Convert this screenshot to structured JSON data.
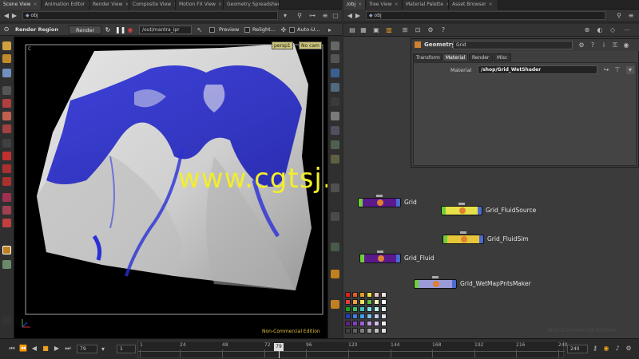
{
  "left_tabs": [
    {
      "label": "Scene View",
      "active": true
    },
    {
      "label": "Animation Editor",
      "active": false
    },
    {
      "label": "Render View",
      "active": false
    },
    {
      "label": "Composite View",
      "active": false
    },
    {
      "label": "Motion FX View",
      "active": false
    },
    {
      "label": "Geometry Spreadsheet",
      "active": false
    }
  ],
  "right_tabs": [
    {
      "label": "/obj",
      "active": true
    },
    {
      "label": "Tree View",
      "active": false
    },
    {
      "label": "Material Palette",
      "active": false
    },
    {
      "label": "Asset Browser",
      "active": false
    }
  ],
  "left_path": "obj",
  "right_path": "obj",
  "render_bar": {
    "region_label": "Render Region",
    "render_button": "Render",
    "output_path": "/out/mantra_ipr",
    "preview_label": "Preview",
    "relight_label": "Relight...",
    "autoupdate_label": "Auto-U..."
  },
  "viewport": {
    "camera_label": "persp1",
    "cam_menu": "No cam",
    "corner_label": "C",
    "watermark_text": "Non-Commercial Edition",
    "overlay_text": "www.cgtsj.com"
  },
  "params": {
    "node_type": "Geometry",
    "node_name": "Grid",
    "tabs": [
      "Transform",
      "Material",
      "Render",
      "Misc"
    ],
    "active_tab": "Material",
    "material_label": "Material",
    "material_value": "/shop/Grid_WetShader"
  },
  "network": {
    "nodes": [
      {
        "label": "Grid",
        "color": "#5b1a8c"
      },
      {
        "label": "Grid_FluidSource",
        "color": "#e8e04a"
      },
      {
        "label": "Grid_FluidSim",
        "color": "#e6c63a"
      },
      {
        "label": "Grid_Fluid",
        "color": "#5b1a8c"
      },
      {
        "label": "Grid_WetMapPntsMaker",
        "color": "#9a9ad8"
      }
    ],
    "watermark_text": "Non-Commercial Edition"
  },
  "timeline": {
    "current_frame": "79",
    "start_frame": "1",
    "end_frame": "240",
    "ticks": [
      "1",
      "24",
      "48",
      "72",
      "96",
      "120",
      "144",
      "168",
      "192",
      "216",
      "240"
    ],
    "playhead_label": "79"
  },
  "colors": {
    "fluid_blue": "#2a2fd6",
    "ground_grey": "#d8d8d8",
    "overlay_yellow": "#f2ee2a",
    "accent_orange": "#f0a020",
    "accent_green": "#6fcf3a"
  },
  "palette_colors": [
    "#e02020",
    "#e06020",
    "#e0a020",
    "#f0e040",
    "#f0c0c0",
    "#f0e0e0",
    "#e04040",
    "#f0a040",
    "#f0e060",
    "#60c040",
    "#f0f0c0",
    "#ffffff",
    "#20a020",
    "#40c060",
    "#40c0c0",
    "#80e0e0",
    "#c0f0f0",
    "#e0f0f0",
    "#2040c0",
    "#4080e0",
    "#40a0f0",
    "#80c0f0",
    "#c0d0f0",
    "#e0e0f0",
    "#602080",
    "#8040c0",
    "#a060e0",
    "#c0a0e0",
    "#d0c0f0",
    "#f0f0f0",
    "#404040",
    "#606060",
    "#808080",
    "#a0a0a0",
    "#c0c0c0",
    "#e0e0e0"
  ]
}
